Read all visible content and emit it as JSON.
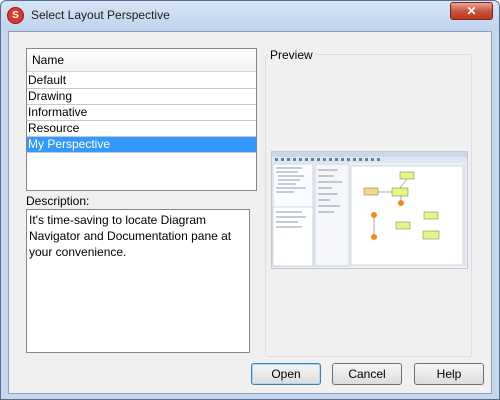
{
  "window": {
    "title": "Select Layout Perspective",
    "close_glyph": "✕",
    "icon": "app-logo-icon"
  },
  "list": {
    "header": "Name",
    "items": [
      "Default",
      "Drawing",
      "Informative",
      "Resource",
      "My Perspective"
    ],
    "selected": "My Perspective"
  },
  "description": {
    "label": "Description:",
    "text": "It's time-saving to locate Diagram Navigator and Documentation pane at your convenience."
  },
  "preview": {
    "label": "Preview"
  },
  "buttons": {
    "open": "Open",
    "cancel": "Cancel",
    "help": "Help"
  },
  "colors": {
    "selection": "#3399ff",
    "title_bar": "#c5d8ee",
    "close_button": "#c8503a"
  }
}
